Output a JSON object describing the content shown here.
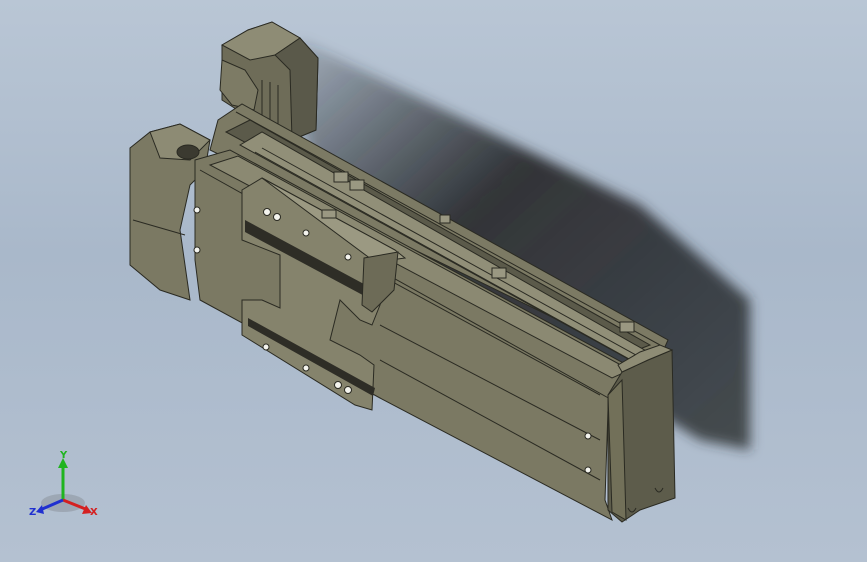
{
  "view": {
    "background_top": "#b9c6d5",
    "background_bottom": "#b4c1d1",
    "model_color": "#7a7862",
    "model_dark": "#5f5e4c",
    "model_light": "#8c8a73",
    "shadow_color": "#3a3d40"
  },
  "triad": {
    "x_label": "X",
    "y_label": "Y",
    "z_label": "Z",
    "x_color": "#d42020",
    "y_color": "#1fb41f",
    "z_color": "#2030d0"
  }
}
